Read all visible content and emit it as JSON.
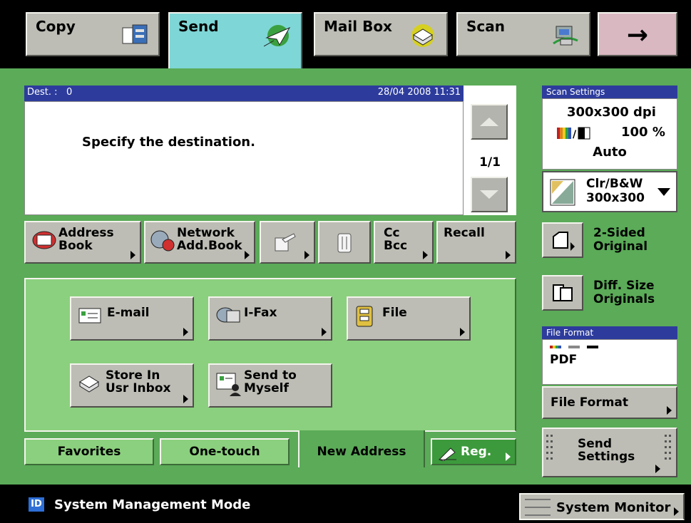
{
  "top_tabs": {
    "copy": "Copy",
    "send": "Send",
    "mailbox": "Mail Box",
    "scan": "Scan",
    "next_icon": "right-arrow-icon"
  },
  "destination": {
    "header_label": "Dest. :",
    "count": "0",
    "datetime": "28/04 2008 11:31",
    "message": "Specify the destination.",
    "page": "1/1"
  },
  "dest_buttons": {
    "address_book": "Address\nBook",
    "network_address_book": "Network\nAdd.Book",
    "cc_bcc": "Cc\nBcc",
    "recall": "Recall"
  },
  "new_address": {
    "email": "E-mail",
    "ifax": "I-Fax",
    "file": "File",
    "store_in_usr_inbox": "Store In\nUsr Inbox",
    "send_to_myself": "Send to\nMyself"
  },
  "bottom_tabs": {
    "favorites": "Favorites",
    "one_touch": "One-touch",
    "new_address": "New Address",
    "reg": "Reg."
  },
  "scan_settings": {
    "header": "Scan Settings",
    "resolution": "300x300 dpi",
    "zoom": "100 %",
    "mode": "Auto",
    "color_select": "Clr/B&W\n300x300"
  },
  "side_options": {
    "two_sided": "2-Sided\nOriginal",
    "diff_size": "Diff. Size\nOriginals"
  },
  "file_format": {
    "header": "File Format",
    "value": "PDF",
    "button": "File Format"
  },
  "send_settings": "Send\nSettings",
  "status_bar": {
    "badge": "ID",
    "mode": "System Management Mode",
    "system_monitor": "System Monitor"
  },
  "colors": {
    "background_green": "#5bab58",
    "panel_green": "#8bd07e",
    "header_blue": "#2d3c9c",
    "send_tab": "#7fd6d6",
    "button_gray": "#bdbdb5"
  }
}
